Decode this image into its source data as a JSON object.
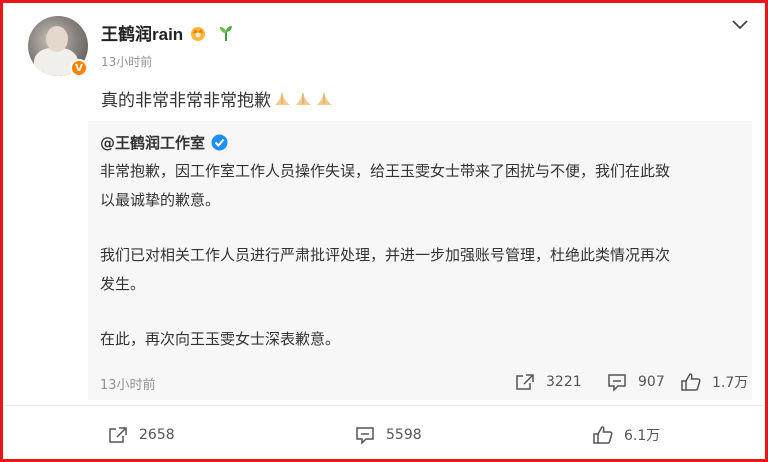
{
  "post": {
    "username": "王鹤润rain",
    "badges": [
      "crown-badge-icon",
      "sprout-badge-icon"
    ],
    "time": "13小时前",
    "text": "真的非常非常非常抱歉",
    "emoji_icons": [
      "folded-hands-icon",
      "folded-hands-icon",
      "folded-hands-icon"
    ]
  },
  "repost": {
    "username": "@王鹤润工作室",
    "verified_icon": "blue-verified-icon",
    "paragraphs": [
      "非常抱歉，因工作室工作人员操作失误，给王玉雯女士带来了困扰与不便，我们在此致",
      "以最诚挚的歉意。",
      "我们已对相关工作人员进行严肃批评处理，并进一步加强账号管理，杜绝此类情况再次",
      "发生。",
      "在此，再次向王玉雯女士深表歉意。"
    ],
    "time": "13小时前",
    "stats": {
      "repost": "3221",
      "comment": "907",
      "like": "1.7万"
    }
  },
  "footer": {
    "repost": "2658",
    "comment": "5598",
    "like": "6.1万"
  },
  "colors": {
    "border": "#e8151b",
    "accent_orange": "#ff8200",
    "verified_blue": "#1e8ff7",
    "muted": "#939393",
    "card_bg": "#f7f7f7"
  }
}
